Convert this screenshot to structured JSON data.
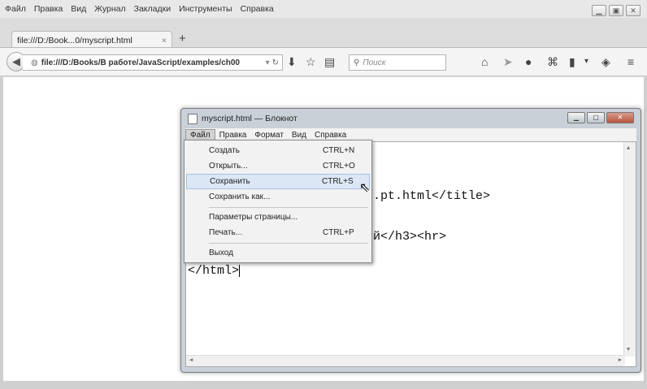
{
  "browser": {
    "menubar": [
      {
        "text": "Файл"
      },
      {
        "text": "Правка"
      },
      {
        "text": "Вид"
      },
      {
        "text": "Журнал"
      },
      {
        "text": "Закладки"
      },
      {
        "text": "Инструменты"
      },
      {
        "text": "Справка"
      }
    ],
    "tab": {
      "title": "file:///D:/Book...0/myscript.html",
      "close": "×",
      "new_tab": "+"
    },
    "url": "file:///D:/Books/В работе/JavaScript/examples/ch00",
    "search_placeholder": "Поиск"
  },
  "notepad": {
    "title": "myscript.html — Блокнот",
    "menus": [
      "Файл",
      "Правка",
      "Формат",
      "Вид",
      "Справка"
    ],
    "lines": [
      {
        "text": ".pt.html</title>"
      },
      {
        "text": "й</h3><hr>"
      },
      {
        "text": "</html>"
      }
    ]
  },
  "file_menu": {
    "items": [
      {
        "label": "Создать",
        "shortcut": "CTRL+N"
      },
      {
        "label": "Открыть...",
        "shortcut": "CTRL+O"
      },
      {
        "label": "Сохранить",
        "shortcut": "CTRL+S"
      },
      {
        "label": "Сохранить как...",
        "shortcut": ""
      },
      {
        "label": "Параметры страницы...",
        "shortcut": ""
      },
      {
        "label": "Печать...",
        "shortcut": "CTRL+P"
      },
      {
        "label": "Выход",
        "shortcut": ""
      }
    ],
    "highlighted": "Сохранить"
  },
  "icons": {
    "back": "back-arrow-icon",
    "globe": "globe-icon",
    "reload": "reload-icon",
    "download": "download-icon",
    "bookmark": "star-icon",
    "reader": "reader-icon",
    "home": "home-icon",
    "send": "send-icon",
    "chat": "chat-icon",
    "addons": "puzzle-icon",
    "library": "library-icon",
    "sync": "sync-icon",
    "menu": "hamburger-menu-icon"
  }
}
